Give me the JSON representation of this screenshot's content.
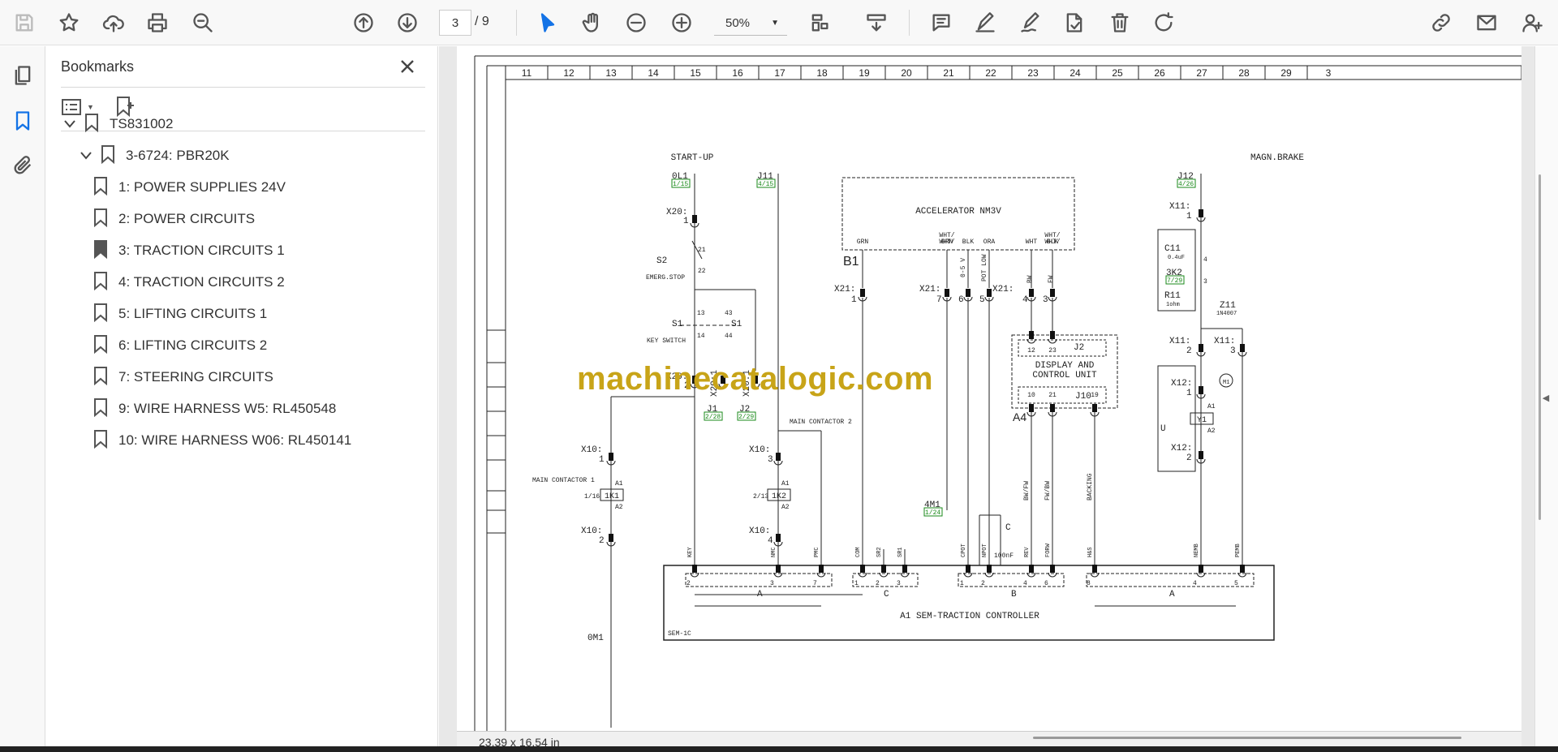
{
  "toolbar": {
    "current_page": "3",
    "total_pages": "/ 9",
    "zoom": "50%",
    "icons": [
      "save-icon",
      "star-icon",
      "upload-icon",
      "print-icon",
      "zoom-search-icon",
      "page-up-icon",
      "page-down-icon",
      "cursor-icon",
      "hand-icon",
      "zoom-out-icon",
      "zoom-in-icon",
      "page-fit-icon",
      "scroll-mode-icon",
      "comment-icon",
      "highlight-pen-icon",
      "sign-pen-icon",
      "stamp-icon",
      "delete-icon",
      "rotate-icon",
      "link-icon",
      "mail-icon",
      "account-icon"
    ]
  },
  "bookmarks": {
    "title": "Bookmarks",
    "items": [
      {
        "label": "TS831002",
        "level": 0,
        "expanded": true
      },
      {
        "label": "3-6724: PBR20K",
        "level": 1,
        "expanded": true
      },
      {
        "label": "1: POWER SUPPLIES 24V",
        "level": 2
      },
      {
        "label": "2: POWER CIRCUITS",
        "level": 2
      },
      {
        "label": "3: TRACTION CIRCUITS 1",
        "level": 2,
        "current": true
      },
      {
        "label": "4: TRACTION CIRCUITS 2",
        "level": 2
      },
      {
        "label": "5: LIFTING CIRCUITS 1",
        "level": 2
      },
      {
        "label": "6: LIFTING CIRCUITS 2",
        "level": 2
      },
      {
        "label": "7: STEERING CIRCUITS",
        "level": 2
      },
      {
        "label": "9: WIRE HARNESS W5: RL450548",
        "level": 2
      },
      {
        "label": "10: WIRE HARNESS W06: RL450141",
        "level": 2
      }
    ]
  },
  "document": {
    "watermark": "machinecatalogic.com",
    "status_size": "23,39 x 16,54 in",
    "grid_columns": [
      "11",
      "12",
      "13",
      "14",
      "15",
      "16",
      "17",
      "18",
      "19",
      "20",
      "21",
      "22",
      "23",
      "24",
      "25",
      "26",
      "27",
      "28",
      "29",
      "3"
    ],
    "labels": {
      "start_up": "START-UP",
      "magn_brake": "MAGN.BRAKE",
      "accelerator": "ACCELERATOR NM3V",
      "b1": "B1",
      "emerg_stop": "EMERG.STOP",
      "key_switch": "KEY SWITCH",
      "display_1": "DISPLAY AND",
      "display_2": "CONTROL UNIT",
      "a4": "A4",
      "j2": "J2",
      "j10": "J10",
      "main_contactor_1": "MAIN CONTACTOR 1",
      "main_contactor_2": "MAIN CONTACTOR 2",
      "controller": "A1 SEM-TRACTION CONTROLLER",
      "sem": "SEM-1C",
      "ol1": "0L1",
      "ol1_ref": "1/15",
      "j11": "J11",
      "j11_ref": "4/15",
      "j12": "J12",
      "j12_ref": "4/26",
      "j1": "J1",
      "j1_ref": "2/28",
      "j2p": "J2",
      "j2p_ref": "2/29",
      "m4m1": "4M1",
      "m4m1_ref": "1/24",
      "om1": "0M1",
      "c11": "C11",
      "c11_val": "0.4uF",
      "k32": "3K2",
      "k32_ref": "7/29",
      "r11": "R11",
      "r11_val": "1ohm",
      "z11": "Z11",
      "z11_val": "1N4007",
      "k1": "1K1",
      "k1_ref": "1/16",
      "k2": "1K2",
      "k2_ref": "2/13",
      "y1": "Y1",
      "m1": "M1",
      "u": "U",
      "c": "C",
      "c_val": "100nF",
      "s2": "S2",
      "s1": "S1"
    }
  }
}
